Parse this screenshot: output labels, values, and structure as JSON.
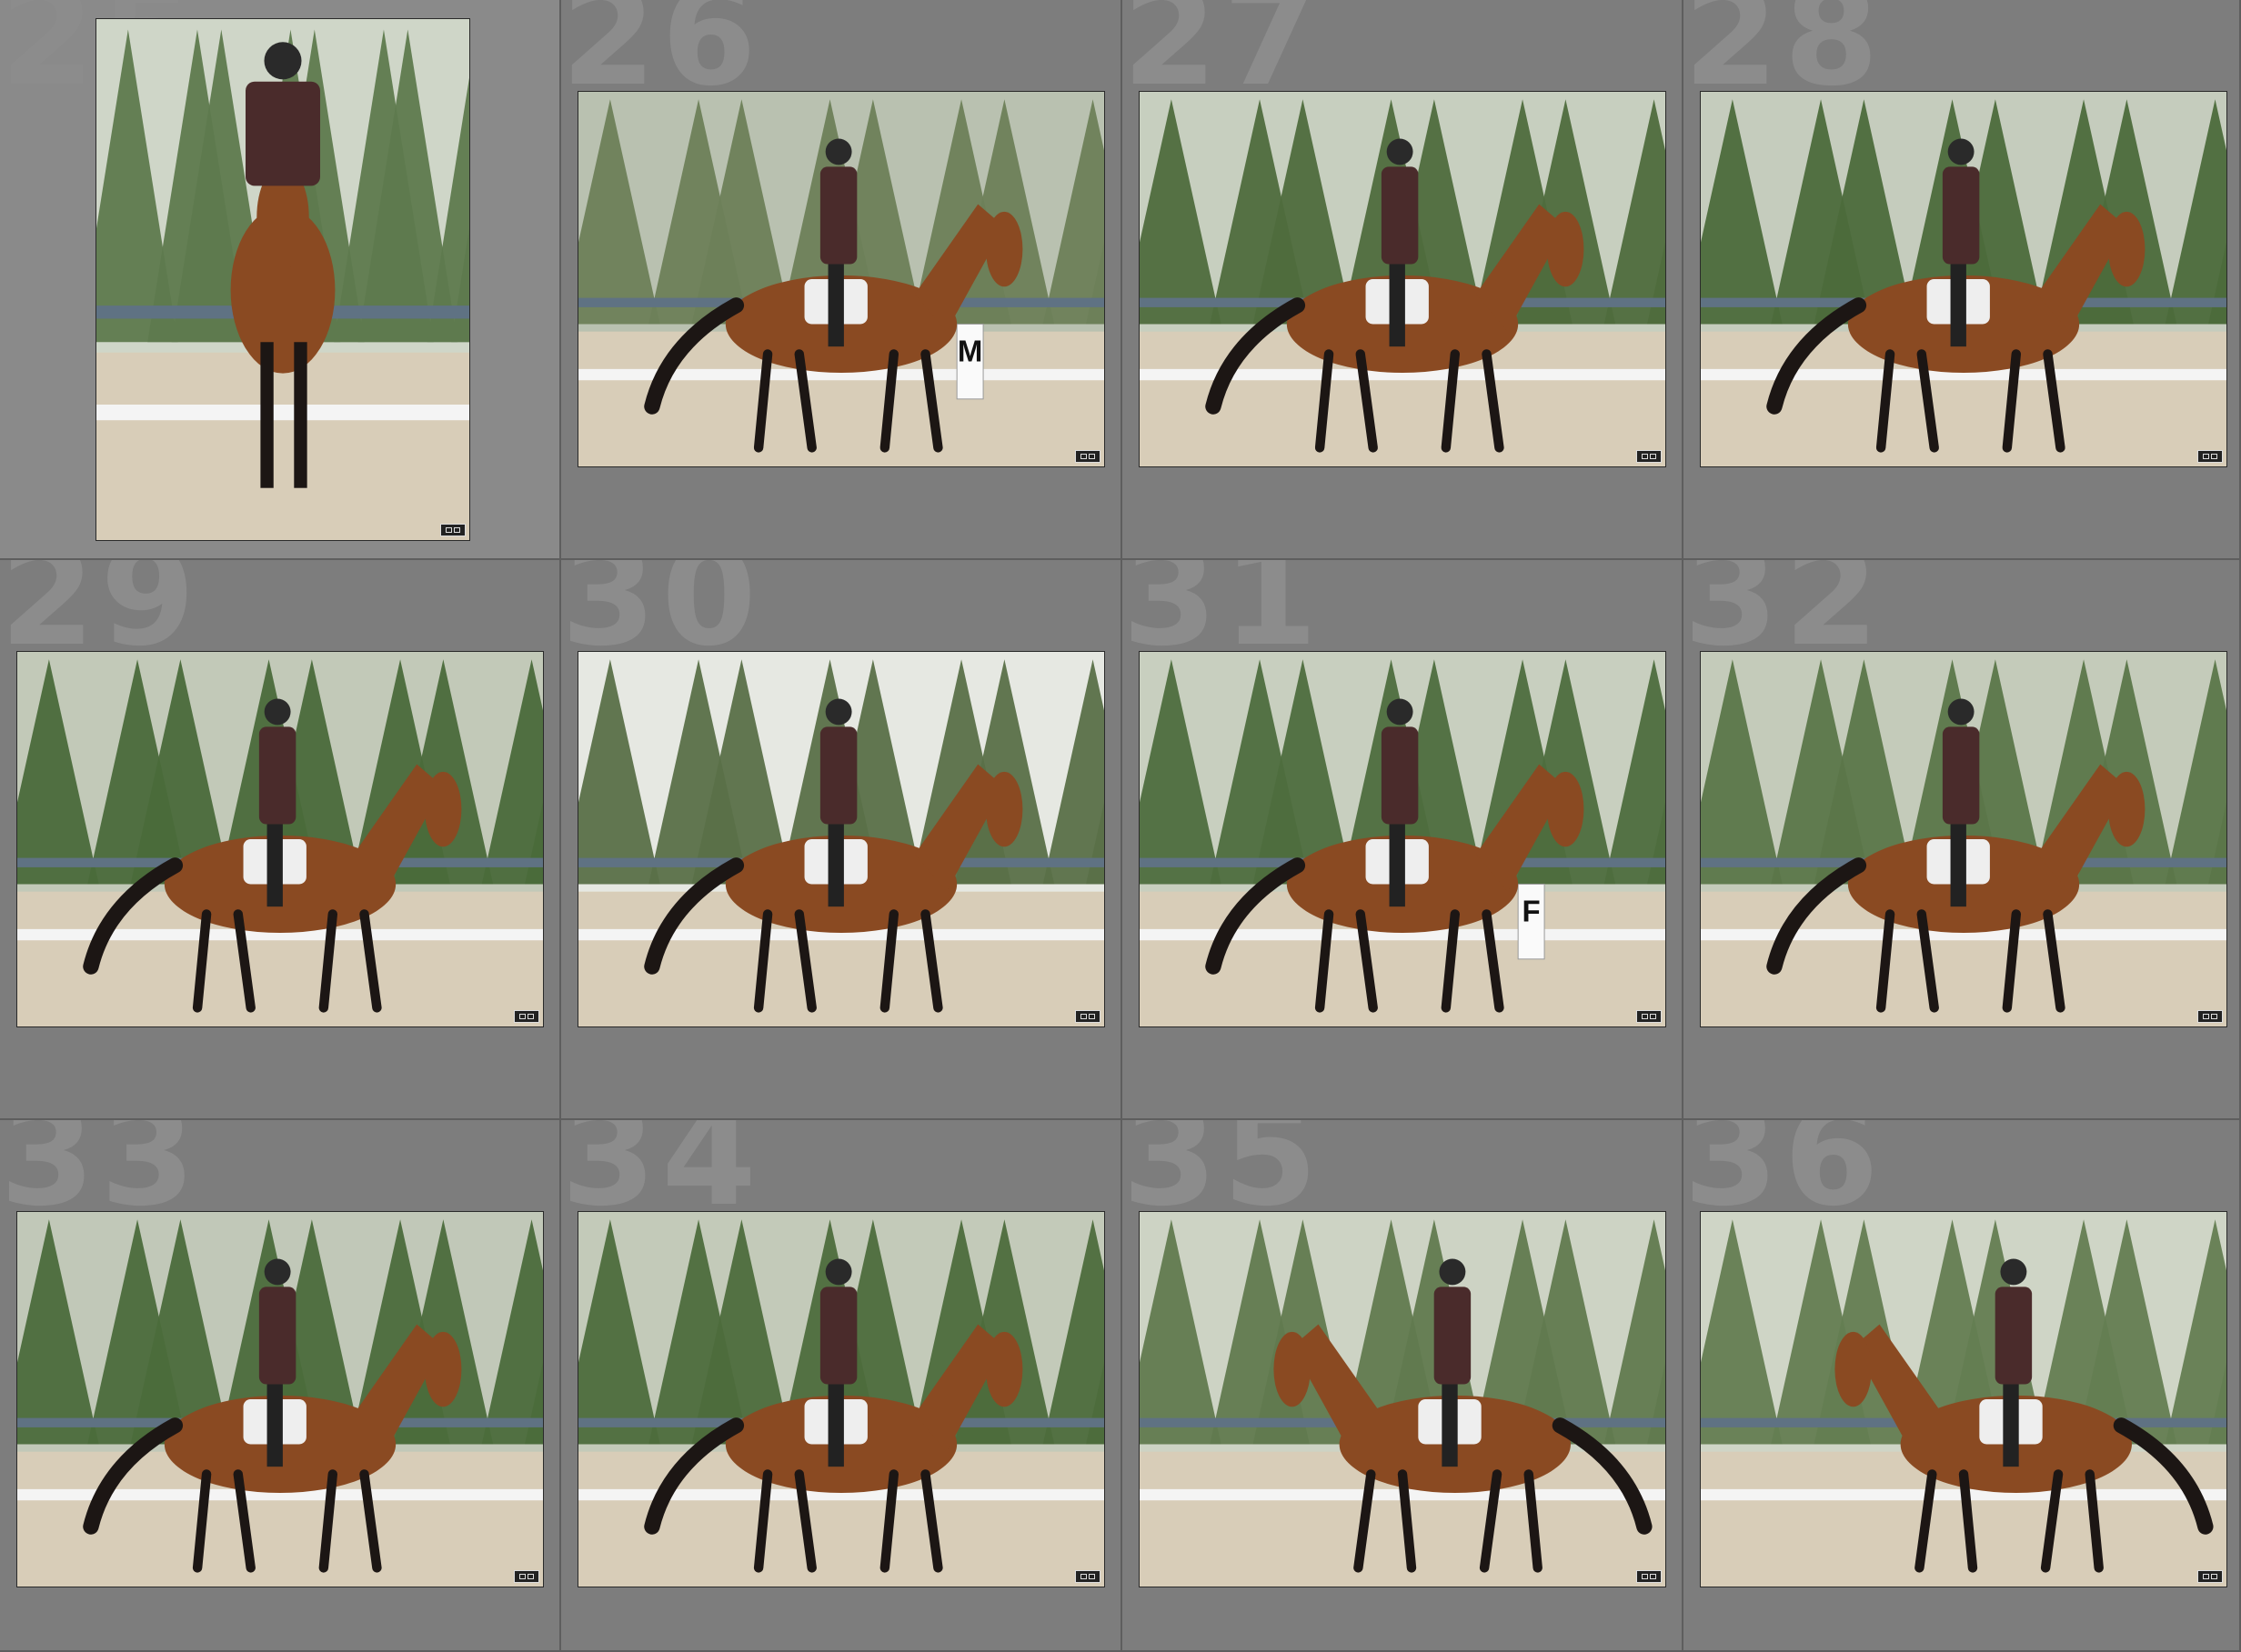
{
  "grid": {
    "cells": [
      {
        "index": "25",
        "orientation": "portrait",
        "direction": "front",
        "bg": "#5e7a4e",
        "sky": "#cfd6c8",
        "marker": "",
        "selected": true
      },
      {
        "index": "26",
        "orientation": "landscape",
        "direction": "right",
        "bg": "#6d8058",
        "sky": "#b9c1b0",
        "marker": "M",
        "selected": false
      },
      {
        "index": "27",
        "orientation": "landscape",
        "direction": "right",
        "bg": "#4f6b3d",
        "sky": "#c7cfbf",
        "marker": "",
        "selected": false
      },
      {
        "index": "28",
        "orientation": "landscape",
        "direction": "right",
        "bg": "#4c6a3b",
        "sky": "#c5ccbd",
        "marker": "",
        "selected": false
      },
      {
        "index": "29",
        "orientation": "landscape",
        "direction": "right",
        "bg": "#4a6a3a",
        "sky": "#c2c9b8",
        "marker": "",
        "selected": false
      },
      {
        "index": "30",
        "orientation": "landscape",
        "direction": "right",
        "bg": "#5a7048",
        "sky": "#e6e8e2",
        "marker": "",
        "selected": false
      },
      {
        "index": "31",
        "orientation": "landscape",
        "direction": "back",
        "bg": "#4e6d3e",
        "sky": "#c8cfbf",
        "marker": "F",
        "selected": false
      },
      {
        "index": "32",
        "orientation": "landscape",
        "direction": "right",
        "bg": "#5b7649",
        "sky": "#c4cbba",
        "marker": "",
        "selected": false
      },
      {
        "index": "33",
        "orientation": "landscape",
        "direction": "right",
        "bg": "#4b6b3b",
        "sky": "#c1c8b8",
        "marker": "",
        "selected": false
      },
      {
        "index": "34",
        "orientation": "landscape",
        "direction": "right",
        "bg": "#4d6c3c",
        "sky": "#c3cab9",
        "marker": "",
        "selected": false
      },
      {
        "index": "35",
        "orientation": "landscape",
        "direction": "left",
        "bg": "#617a4f",
        "sky": "#cdd3c4",
        "marker": "",
        "selected": false
      },
      {
        "index": "36",
        "orientation": "landscape",
        "direction": "left",
        "bg": "#647d52",
        "sky": "#cfd5c6",
        "marker": "",
        "selected": false
      }
    ]
  },
  "colors": {
    "horse": "#8a4a22",
    "horse_dark": "#1c1614",
    "jacket": "#4a2b2b",
    "pad": "#eeeeee",
    "arena": "#d8cdb8",
    "fence": "#5f7283"
  },
  "icons": {
    "badge": "edit-badge-icon"
  }
}
